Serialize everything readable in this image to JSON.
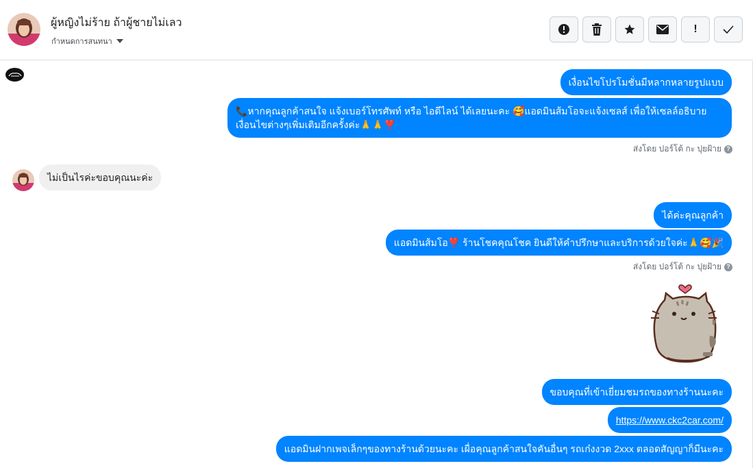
{
  "conversation": {
    "contact_name": "ผู้หญิงไม่ร้าย ถ้าผู้ชายไม่เลว",
    "assign_label": "กำหนดการสนทนา"
  },
  "toolbar": {
    "buttons": [
      {
        "name": "report-spam",
        "icon": "exclamation-circle-icon"
      },
      {
        "name": "delete",
        "icon": "trash-icon"
      },
      {
        "name": "star",
        "icon": "star-icon"
      },
      {
        "name": "mark-unread",
        "icon": "envelope-icon"
      },
      {
        "name": "follow-up",
        "icon": "exclamation-icon",
        "label": "!"
      },
      {
        "name": "mark-done",
        "icon": "check-icon"
      }
    ]
  },
  "messages": {
    "m1": "เงื่อนไขโปรโมชั่นมีหลากหลายรูปแบบ",
    "m2": "📞หากคุณลูกค้าสนใจ แจ้งเบอร์โทรศัพท์ หรือ ไอดีไลน์ ได้เลยนะคะ 🥰แอดมินส้มโอจะแจ้งเซลส์ เพื่อให้เซลล์อธิบายเงื่อนไขต่างๆเพิ่มเติมอีกครั้งค่ะ🙏🙏❣️",
    "sent_by_1": "ส่งโดย ปอร์โต้ กะ ปุยฝ้าย",
    "incoming_1": "ไม่เป็นไรค่ะขอบคุณนะค่ะ",
    "m3": "ได้ค่ะคุณลูกค้า",
    "m4": "แอดมินส้มโอ❣️ ร้านโชคคุณโชค ยินดีให้คำปรึกษาและบริการด้วยใจค่ะ🙏🥰🎉",
    "sent_by_2": "ส่งโดย ปอร์โต้ กะ ปุยฝ้าย",
    "m5": "ขอบคุณที่เข้าเยี่ยมชมรถของทางร้านนะคะ",
    "m6_link": "https://www.ckc2car.com/",
    "m7": "แอดมินฝากเพจเล็กๆของทางร้านด้วยนะคะ เผื่อคุณลูกค้าสนใจคันอื่นๆ รถเก๋งงวด 2xxx ตลอดสัญญาก็มีนะคะ"
  },
  "colors": {
    "outgoing_bubble": "#0084ff",
    "incoming_bubble": "#f1f0f0",
    "text_secondary": "#606770"
  }
}
